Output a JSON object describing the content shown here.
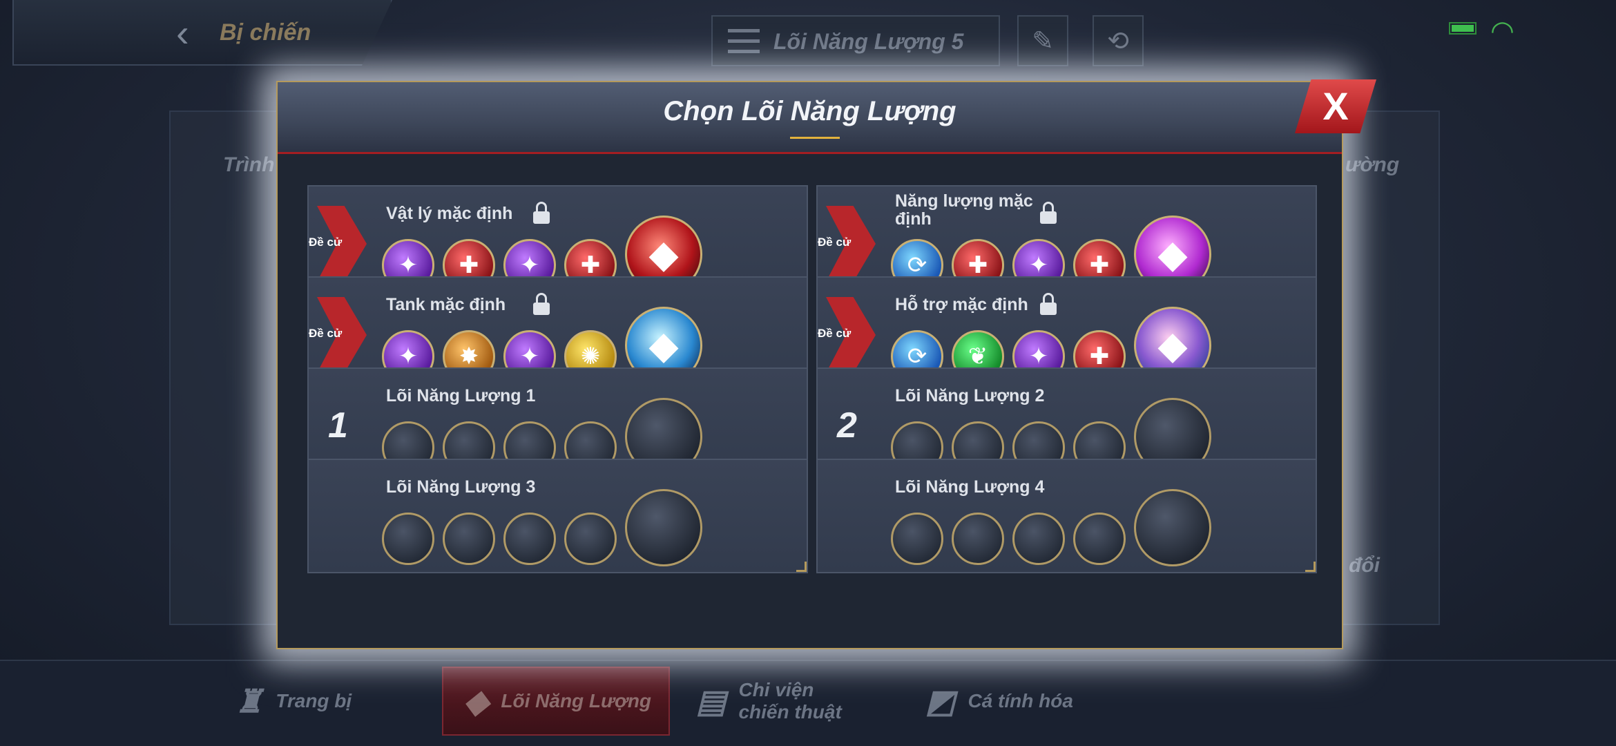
{
  "top_bar": {
    "back_label": "Bị chiến",
    "loadout_name": "Lõi Năng Lượng 5",
    "edit_icon": "pencil-icon",
    "swap_icon": "swap-icon"
  },
  "background": {
    "ghost_left_top": "Trình",
    "ghost_right_top": "ường",
    "ghost_right_bottom": "đổi"
  },
  "modal": {
    "title": "Chọn Lõi Năng Lượng",
    "close_label": "X",
    "presets": [
      {
        "tag": "Đề cử",
        "name": "Vật lý mặc định",
        "locked": true,
        "runes": [
          "purple",
          "red",
          "purple",
          "red"
        ],
        "core": "red"
      },
      {
        "tag": "Đề cử",
        "name": "Năng lượng mặc định",
        "locked": true,
        "runes": [
          "blue",
          "red",
          "purple",
          "red"
        ],
        "core": "pink"
      },
      {
        "tag": "Đề cử",
        "name": "Tank mặc định",
        "locked": true,
        "runes": [
          "purple",
          "orange",
          "purple",
          "gold"
        ],
        "core": "ice"
      },
      {
        "tag": "Đề cử",
        "name": "Hỗ trợ mặc định",
        "locked": true,
        "runes": [
          "blue",
          "green",
          "purple",
          "red"
        ],
        "core": "rainbow"
      }
    ],
    "custom_slots": [
      {
        "number": "1",
        "name": "Lõi Năng Lượng 1"
      },
      {
        "number": "2",
        "name": "Lõi Năng Lượng 2"
      },
      {
        "number": "",
        "name": "Lõi Năng Lượng 3"
      },
      {
        "number": "",
        "name": "Lõi Năng Lượng 4"
      }
    ]
  },
  "bottom_nav": [
    {
      "label": "Trang bị",
      "icon": "armor-icon",
      "active": false
    },
    {
      "label": "Lõi Năng Lượng",
      "icon": "core-icon",
      "active": true
    },
    {
      "label": "Chi viện chiến thuật",
      "icon": "tactics-icon",
      "active": false
    },
    {
      "label": "Cá tính hóa",
      "icon": "customize-icon",
      "active": false
    }
  ],
  "status": {
    "battery_color": "#3fbf4f",
    "wifi_color": "#44b04f"
  }
}
